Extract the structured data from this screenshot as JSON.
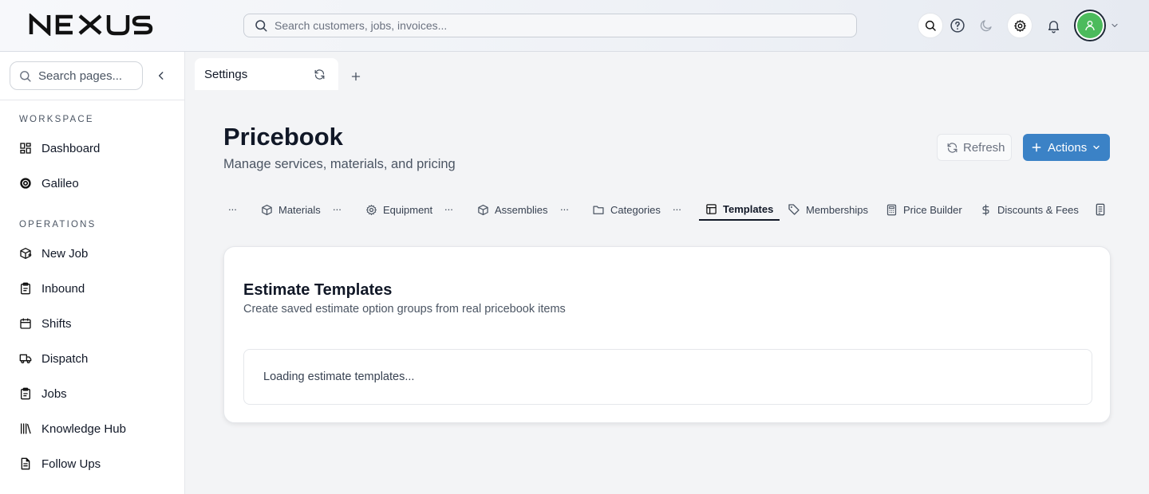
{
  "app": {
    "brand": "NEXUS",
    "search_placeholder": "Search customers, jobs, invoices..."
  },
  "topbar_icons": [
    "search-icon",
    "help-icon",
    "moon-icon",
    "gear-icon",
    "bell-icon",
    "user-icon",
    "chevron-down-icon"
  ],
  "sidebar": {
    "search_placeholder": "Search pages...",
    "sections": [
      {
        "label": "WORKSPACE",
        "items": [
          {
            "label": "Dashboard",
            "icon": "grid-icon"
          },
          {
            "label": "Galileo",
            "icon": "galileo-icon"
          }
        ]
      },
      {
        "label": "OPERATIONS",
        "items": [
          {
            "label": "New Job",
            "icon": "new-job-icon"
          },
          {
            "label": "Inbound",
            "icon": "clipboard-icon"
          },
          {
            "label": "Shifts",
            "icon": "calendar-icon"
          },
          {
            "label": "Dispatch",
            "icon": "truck-icon"
          },
          {
            "label": "Jobs",
            "icon": "clipboard-icon"
          },
          {
            "label": "Knowledge Hub",
            "icon": "library-icon"
          },
          {
            "label": "Follow Ups",
            "icon": "file-icon"
          }
        ]
      }
    ]
  },
  "tabs": {
    "current": "Settings"
  },
  "header": {
    "title": "Pricebook",
    "subtitle": "Manage services, materials, and pricing",
    "refresh_label": "Refresh",
    "actions_label": "Actions"
  },
  "subtabs": {
    "ellipsis": "...",
    "items": [
      {
        "label": "Materials",
        "icon": "box-icon"
      },
      {
        "label": "Equipment",
        "icon": "gear-icon"
      },
      {
        "label": "Assemblies",
        "icon": "box-icon"
      },
      {
        "label": "Categories",
        "icon": "folder-icon"
      },
      {
        "label": "Templates",
        "icon": "template-icon",
        "active": true
      },
      {
        "label": "Memberships",
        "icon": "tag-icon"
      },
      {
        "label": "Price Builder",
        "icon": "calculator-icon"
      },
      {
        "label": "Discounts & Fees",
        "icon": "dollar-icon"
      }
    ]
  },
  "card": {
    "title": "Estimate Templates",
    "description": "Create saved estimate option groups from real pricebook items",
    "loading_text": "Loading estimate templates..."
  },
  "colors": {
    "accent": "#3b82c6",
    "avatar": "#4cbb5c",
    "text": "#111827",
    "muted": "#4b5563"
  }
}
